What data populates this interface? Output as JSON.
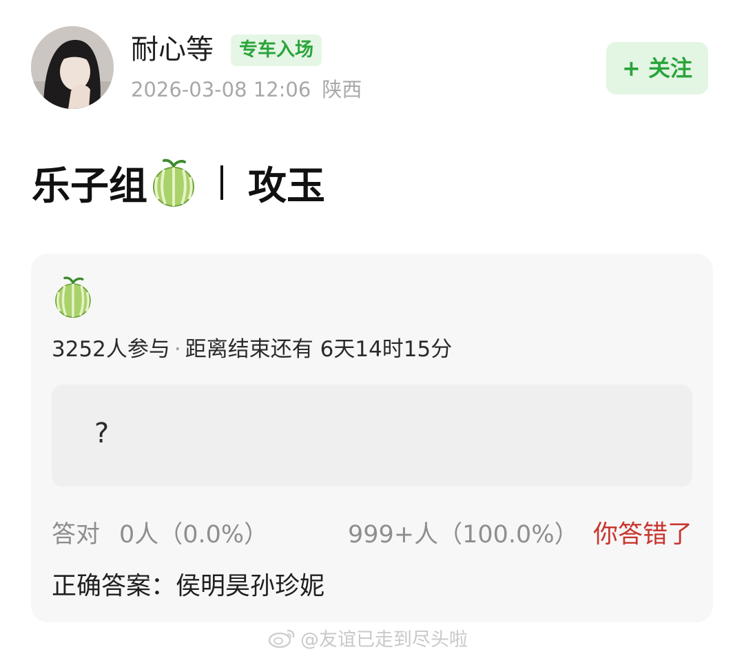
{
  "author": {
    "name": "耐心等",
    "badge": "专车入场",
    "datetime": "2026-03-08 12:06",
    "location": "陕西"
  },
  "follow": {
    "label": "+ 关注"
  },
  "post": {
    "title_left": "乐子组",
    "title_right": "攻玉",
    "icon": "melon-emoji"
  },
  "quiz": {
    "icon": "melon-emoji",
    "participants": "3252人参与",
    "separator": "·",
    "countdown": "距离结束还有 6天14时15分",
    "question": "?",
    "correct_label": "答对",
    "correct_count": "0人（0.0%）",
    "wrong_count": "999+人（100.0%）",
    "verdict": "你答错了",
    "answer": "正确答案：侯明昊孙珍妮"
  },
  "watermark": {
    "text": "@友谊已走到尽头啦",
    "icon": "weibo-icon"
  },
  "colors": {
    "accent_green": "#2aa43a",
    "badge_bg": "#e6f6e6",
    "error_red": "#c8352f",
    "card_bg": "#f7f7f7"
  }
}
